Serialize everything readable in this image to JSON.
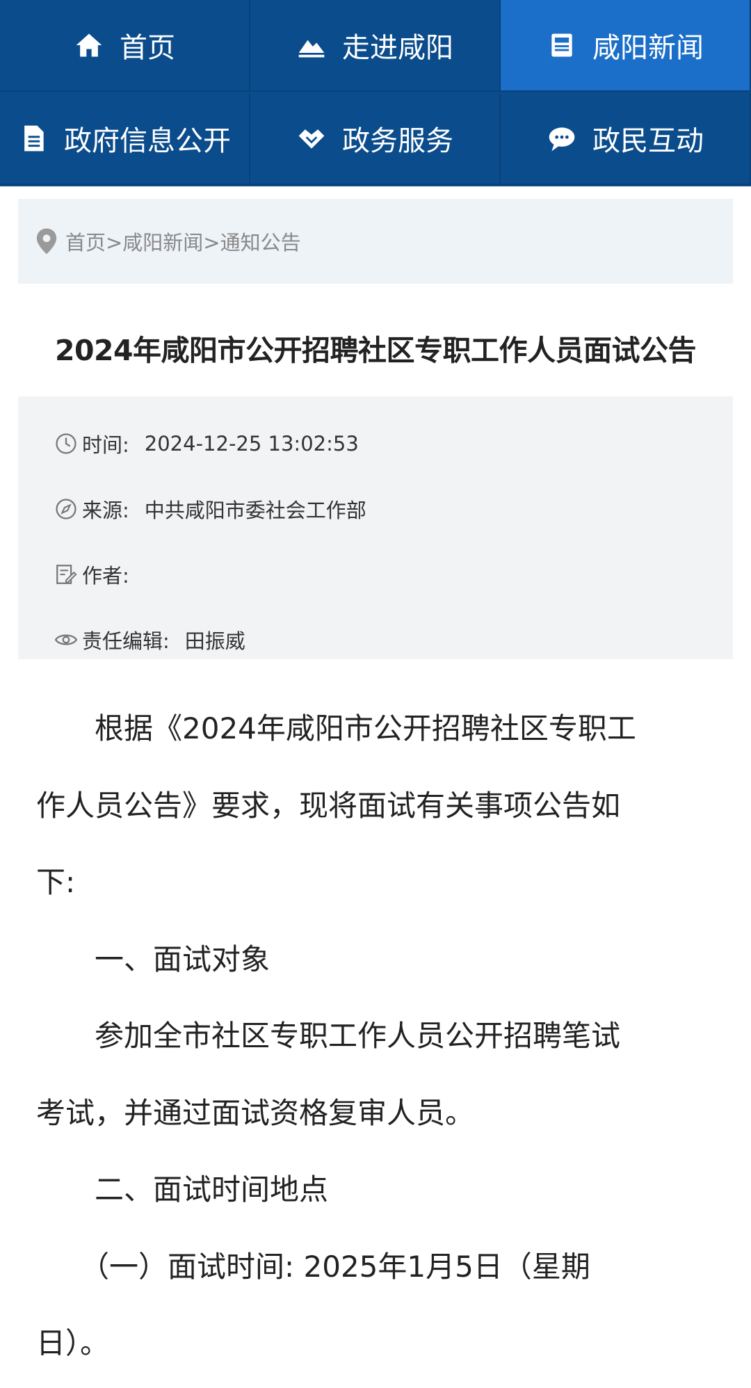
{
  "nav": {
    "items": [
      {
        "label": "首页",
        "icon": "home-icon"
      },
      {
        "label": "走进咸阳",
        "icon": "mountain-icon"
      },
      {
        "label": "咸阳新闻",
        "icon": "news-icon",
        "active": true
      },
      {
        "label": "政府信息公开",
        "icon": "document-icon"
      },
      {
        "label": "政务服务",
        "icon": "handshake-icon"
      },
      {
        "label": "政民互动",
        "icon": "chat-icon"
      }
    ]
  },
  "breadcrumb": {
    "text": "首页>咸阳新闻>通知公告",
    "icon": "location-pin-icon"
  },
  "article": {
    "title": "2024年咸阳市公开招聘社区专职工作人员面试公告",
    "meta": {
      "time_label": "时间:",
      "time_value": "2024-12-25 13:02:53",
      "source_label": "来源:",
      "source_value": "中共咸阳市委社会工作部",
      "author_label": "作者:",
      "author_value": "",
      "editor_label": "责任编辑:",
      "editor_value": "田振威"
    },
    "lines": [
      "　　根据《2024年咸阳市公开招聘社区专职工",
      "作人员公告》要求，现将面试有关事项公告如",
      "下:",
      "　　一、面试对象",
      "　　参加全市社区专职工作人员公开招聘笔试",
      "考试，并通过面试资格复审人员。",
      "　　二、面试时间地点",
      "　　（一）面试时间: 2025年1月5日（星期",
      "日）。"
    ]
  },
  "colors": {
    "nav_bg": "#0b4c8c",
    "nav_active": "#1b6fc9",
    "panel_bg": "#eef3f8"
  }
}
